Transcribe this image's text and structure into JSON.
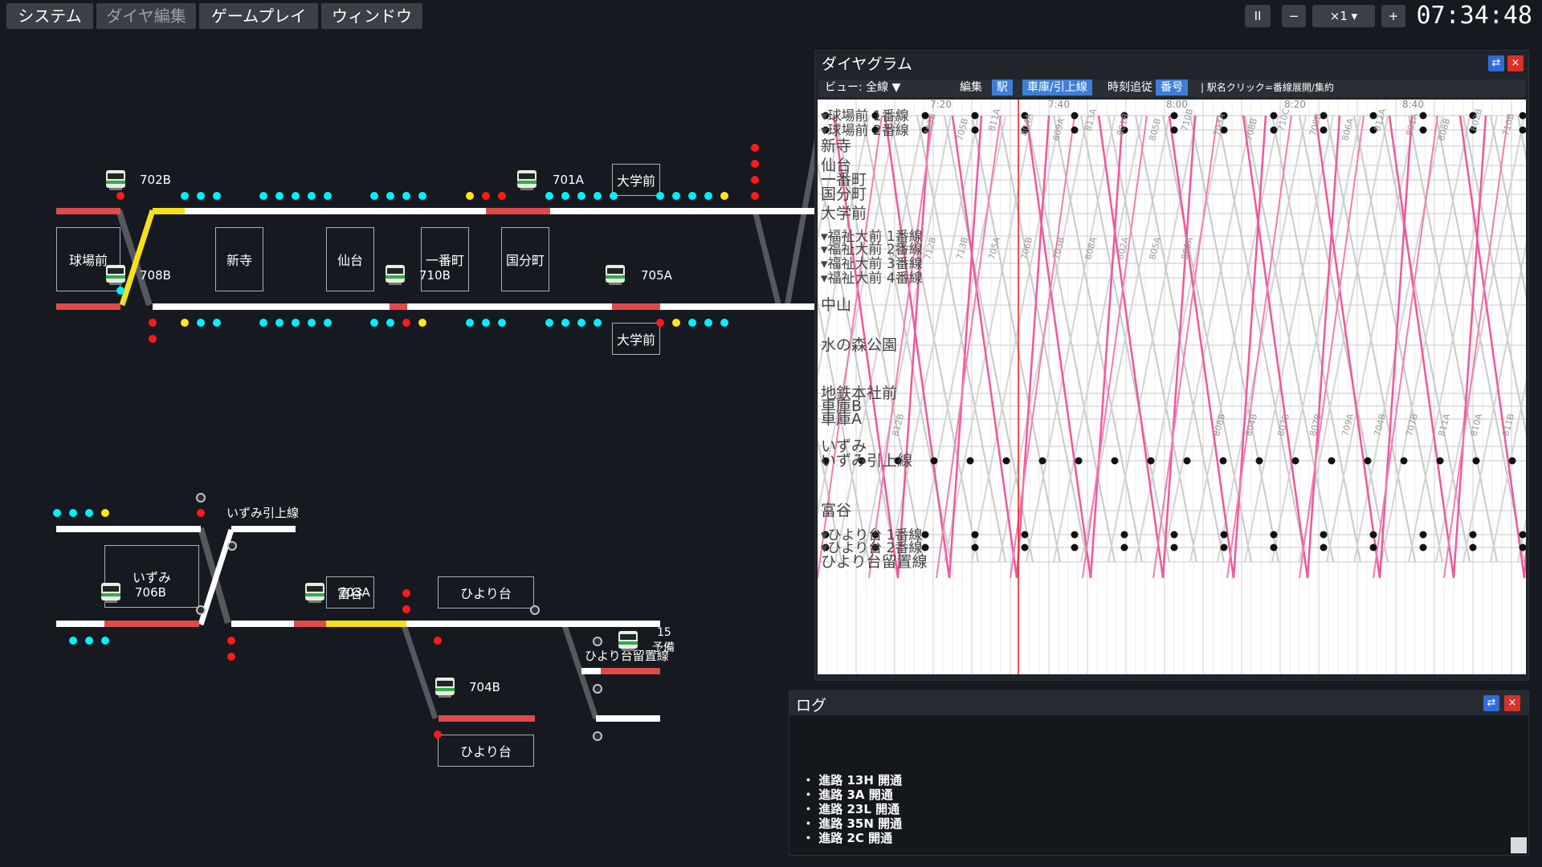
{
  "menu": {
    "system": "システム",
    "dia_edit": "ダイヤ編集",
    "gameplay": "ゲームプレイ",
    "window": "ウィンドウ"
  },
  "controls": {
    "pause": "II",
    "minus": "−",
    "speed": "×1 ▾",
    "plus": "+"
  },
  "clock": "07:34:48",
  "stations": {
    "tamabamae": "球場前",
    "shindera": "新寺",
    "sendai": "仙台",
    "ichibancho": "一番町",
    "kokubuncho": "国分町",
    "daigakumae_top": "大学前",
    "daigakumae_bottom": "大学前",
    "izumi": "いずみ",
    "tomiya": "富谷",
    "hiyoridai_top": "ひより台",
    "hiyoridai_bottom": "ひより台"
  },
  "tracks": {
    "izumi_siding": "いずみ引上線",
    "hiyoridai_siding": "ひより台留置線",
    "spare_num": "15",
    "spare": "予備"
  },
  "trains": {
    "t702B": "702B",
    "t708B": "708B",
    "t710B": "710B",
    "t701A": "701A",
    "t705A": "705A",
    "t706B": "706B",
    "t703A": "703A",
    "t704B": "704B"
  },
  "diagram": {
    "title": "ダイヤグラム",
    "view_label": "ビュー: 全線 ▼",
    "toolbar": {
      "edit": "編集",
      "station": "駅",
      "vehicle": "車庫/引上線",
      "follow": "時刻追従",
      "number": "番号",
      "hint": "| 駅名クリック=番線展開/集約"
    },
    "time_ticks": [
      "7:20",
      "7:40",
      "8:00",
      "8:20",
      "8:40"
    ],
    "station_labels": [
      "▾球場前 1番線",
      "▾球場前 2番線",
      "新寺",
      "仙台",
      "一番町",
      "国分町",
      "大学前",
      "▾福祉大前 1番線",
      "▾福祉大前 2番線",
      "▾福祉大前 3番線",
      "▾福祉大前 4番線",
      "中山",
      "水の森公園",
      "地鉄本社前",
      "車庫B",
      "車庫A",
      "いずみ",
      "いずみ引上線",
      "富谷",
      "▾ひより台 1番線",
      "▾ひより台 2番線",
      "ひより台留置線"
    ],
    "train_numbers": [
      "701A",
      "703B",
      "705B",
      "811A",
      "804A",
      "809A",
      "813A",
      "801B",
      "805B",
      "710B",
      "703A",
      "708B",
      "710C",
      "708B",
      "806A",
      "812A",
      "801A",
      "808B",
      "802B",
      "710B",
      "711B",
      "712B",
      "713B",
      "705A",
      "706B",
      "703B",
      "808A",
      "802A",
      "805A",
      "809A",
      "808B",
      "804B",
      "803B",
      "807B",
      "709A",
      "704B",
      "707B",
      "811A",
      "810A",
      "811B",
      "812B"
    ]
  },
  "log": {
    "title": "ログ",
    "lines": [
      "・ 進路 13H 開通",
      "・ 進路 3A 開通",
      "・ 進路 23L 開通",
      "・ 進路 35N 開通",
      "・ 進路 2C 開通"
    ]
  }
}
